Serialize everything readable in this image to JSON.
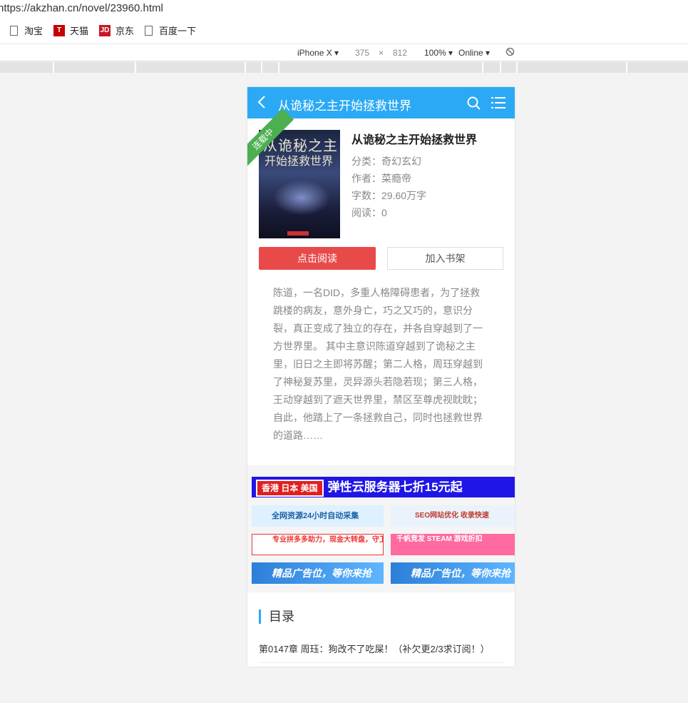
{
  "browser": {
    "url": "https://akzhan.cn/novel/23960.html",
    "bookmarks": [
      {
        "label": "淘宝",
        "icon": "page-icon"
      },
      {
        "label": "天猫",
        "icon": "tmall-icon"
      },
      {
        "label": "京东",
        "icon": "jd-icon"
      },
      {
        "label": "百度一下",
        "icon": "page-icon"
      }
    ],
    "devtools": {
      "device": "iPhone X",
      "width": "375",
      "times": "×",
      "height": "812",
      "zoom": "100%",
      "network": "Online"
    }
  },
  "header": {
    "title": "从诡秘之主开始拯救世界"
  },
  "book": {
    "ribbon": "连载中",
    "cover_title_1": "从诡秘之主",
    "cover_title_2": "开始拯救世界",
    "name": "从诡秘之主开始拯救世界",
    "category": "分类：奇幻玄幻",
    "author": "作者：菜瘾帝",
    "words": "字数：29.60万字",
    "reads": "阅读：0"
  },
  "buttons": {
    "read": "点击阅读",
    "shelf": "加入书架"
  },
  "intro": "陈道，一名DID，多重人格障碍患者，为了拯救跳楼的病友，意外身亡，巧之又巧的，意识分裂，真正变成了独立的存在，并各自穿越到了一方世界里。 其中主意识陈道穿越到了诡秘之主里，旧日之主即将苏醒；第二人格，周珏穿越到了神秘复苏里，灵异源头若隐若现；第三人格，王动穿越到了遮天世界里，禁区至尊虎视眈眈；自此，他踏上了一条拯救自己，同时也拯救世界的道路……",
  "ads": {
    "top_tag": "香港 日本 美国",
    "top_text": "弹性云服务器七折15元起",
    "a1": "全网资源24小时自动采集",
    "a2": "SEO网站优化 收录快速",
    "b1": "专业拼多多助力，现金大转盘，守卫现金",
    "b2": "千帆竞发 STEAM 游戏折扣",
    "c1": "精品广告位，等你来抢",
    "c2": "精品广告位，等你来抢"
  },
  "toc": {
    "title": "目录",
    "latest": "第0147章 周珏：狗改不了吃屎！（补欠更2/3求订阅！）"
  }
}
